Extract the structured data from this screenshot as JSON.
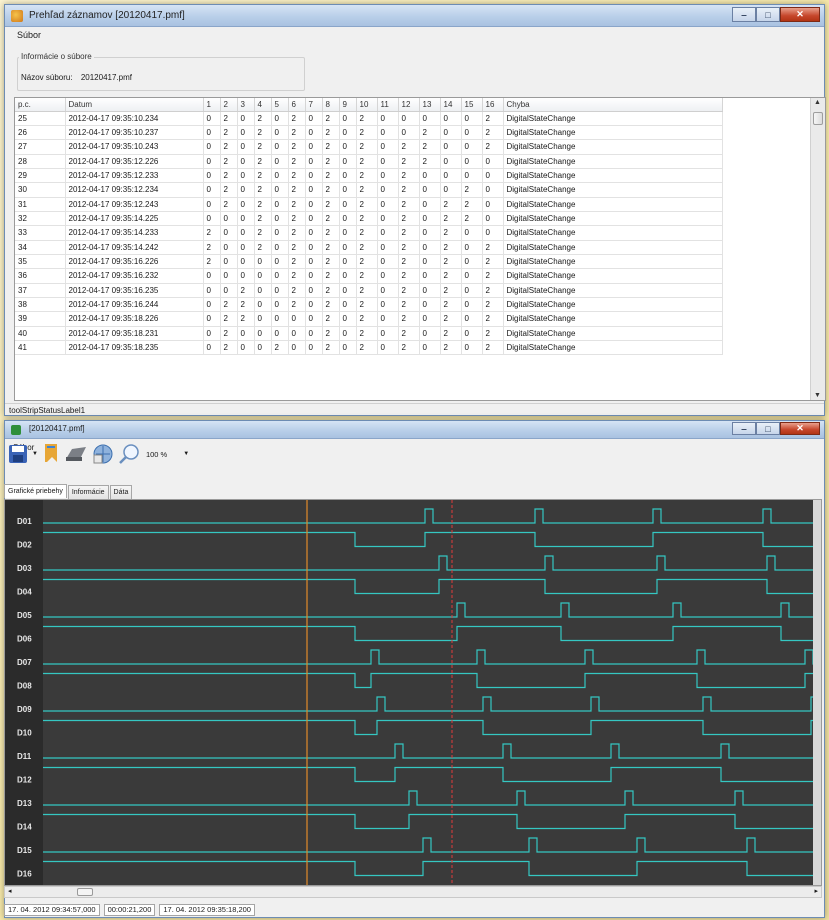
{
  "top_window": {
    "title": "Prehľad záznamov [20120417.pmf]",
    "menu": [
      "Súbor"
    ],
    "file_info": {
      "legend": "Informácie o súbore",
      "filename_label": "Názov súboru:",
      "filename_value": "20120417.pmf"
    },
    "table": {
      "columns": [
        "p.c.",
        "Datum",
        "1",
        "2",
        "3",
        "4",
        "5",
        "6",
        "7",
        "8",
        "9",
        "10",
        "11",
        "12",
        "13",
        "14",
        "15",
        "16",
        "Chyba"
      ],
      "rows": [
        [
          "25",
          "2012-04-17 09:35:10.234",
          "0",
          "2",
          "0",
          "2",
          "0",
          "2",
          "0",
          "2",
          "0",
          "2",
          "0",
          "0",
          "0",
          "0",
          "0",
          "2",
          "DigitalStateChange"
        ],
        [
          "26",
          "2012-04-17 09:35:10.237",
          "0",
          "2",
          "0",
          "2",
          "0",
          "2",
          "0",
          "2",
          "0",
          "2",
          "0",
          "0",
          "2",
          "0",
          "0",
          "2",
          "DigitalStateChange"
        ],
        [
          "27",
          "2012-04-17 09:35:10.243",
          "0",
          "2",
          "0",
          "2",
          "0",
          "2",
          "0",
          "2",
          "0",
          "2",
          "0",
          "2",
          "2",
          "0",
          "0",
          "2",
          "DigitalStateChange"
        ],
        [
          "28",
          "2012-04-17 09:35:12.226",
          "0",
          "2",
          "0",
          "2",
          "0",
          "2",
          "0",
          "2",
          "0",
          "2",
          "0",
          "2",
          "2",
          "0",
          "0",
          "0",
          "DigitalStateChange"
        ],
        [
          "29",
          "2012-04-17 09:35:12.233",
          "0",
          "2",
          "0",
          "2",
          "0",
          "2",
          "0",
          "2",
          "0",
          "2",
          "0",
          "2",
          "0",
          "0",
          "0",
          "0",
          "DigitalStateChange"
        ],
        [
          "30",
          "2012-04-17 09:35:12.234",
          "0",
          "2",
          "0",
          "2",
          "0",
          "2",
          "0",
          "2",
          "0",
          "2",
          "0",
          "2",
          "0",
          "0",
          "2",
          "0",
          "DigitalStateChange"
        ],
        [
          "31",
          "2012-04-17 09:35:12.243",
          "0",
          "2",
          "0",
          "2",
          "0",
          "2",
          "0",
          "2",
          "0",
          "2",
          "0",
          "2",
          "0",
          "2",
          "2",
          "0",
          "DigitalStateChange"
        ],
        [
          "32",
          "2012-04-17 09:35:14.225",
          "0",
          "0",
          "0",
          "2",
          "0",
          "2",
          "0",
          "2",
          "0",
          "2",
          "0",
          "2",
          "0",
          "2",
          "2",
          "0",
          "DigitalStateChange"
        ],
        [
          "33",
          "2012-04-17 09:35:14.233",
          "2",
          "0",
          "0",
          "2",
          "0",
          "2",
          "0",
          "2",
          "0",
          "2",
          "0",
          "2",
          "0",
          "2",
          "0",
          "0",
          "DigitalStateChange"
        ],
        [
          "34",
          "2012-04-17 09:35:14.242",
          "2",
          "0",
          "0",
          "2",
          "0",
          "2",
          "0",
          "2",
          "0",
          "2",
          "0",
          "2",
          "0",
          "2",
          "0",
          "2",
          "DigitalStateChange"
        ],
        [
          "35",
          "2012-04-17 09:35:16.226",
          "2",
          "0",
          "0",
          "0",
          "0",
          "2",
          "0",
          "2",
          "0",
          "2",
          "0",
          "2",
          "0",
          "2",
          "0",
          "2",
          "DigitalStateChange"
        ],
        [
          "36",
          "2012-04-17 09:35:16.232",
          "0",
          "0",
          "0",
          "0",
          "0",
          "2",
          "0",
          "2",
          "0",
          "2",
          "0",
          "2",
          "0",
          "2",
          "0",
          "2",
          "DigitalStateChange"
        ],
        [
          "37",
          "2012-04-17 09:35:16.235",
          "0",
          "0",
          "2",
          "0",
          "0",
          "2",
          "0",
          "2",
          "0",
          "2",
          "0",
          "2",
          "0",
          "2",
          "0",
          "2",
          "DigitalStateChange"
        ],
        [
          "38",
          "2012-04-17 09:35:16.244",
          "0",
          "2",
          "2",
          "0",
          "0",
          "2",
          "0",
          "2",
          "0",
          "2",
          "0",
          "2",
          "0",
          "2",
          "0",
          "2",
          "DigitalStateChange"
        ],
        [
          "39",
          "2012-04-17 09:35:18.226",
          "0",
          "2",
          "2",
          "0",
          "0",
          "0",
          "0",
          "2",
          "0",
          "2",
          "0",
          "2",
          "0",
          "2",
          "0",
          "2",
          "DigitalStateChange"
        ],
        [
          "40",
          "2012-04-17 09:35:18.231",
          "0",
          "2",
          "0",
          "0",
          "0",
          "0",
          "0",
          "2",
          "0",
          "2",
          "0",
          "2",
          "0",
          "2",
          "0",
          "2",
          "DigitalStateChange"
        ],
        [
          "41",
          "2012-04-17 09:35:18.235",
          "0",
          "2",
          "0",
          "0",
          "2",
          "0",
          "0",
          "2",
          "0",
          "2",
          "0",
          "2",
          "0",
          "2",
          "0",
          "2",
          "DigitalStateChange"
        ]
      ]
    },
    "status_label": "toolStripStatusLabel1"
  },
  "bottom_window": {
    "title": "[20120417.pmf]",
    "menu": [
      "Súbor"
    ],
    "toolbar": {
      "zoom_value": "100 %",
      "icons": [
        "save-icon",
        "dropdown-arrow-icon",
        "bookmark-icon",
        "print-icon",
        "globe-settings-icon",
        "zoom-icon"
      ]
    },
    "tabs": [
      "Grafické priebehy",
      "Informácie",
      "Dáta"
    ],
    "active_tab": 0,
    "channels": [
      "D01",
      "D02",
      "D03",
      "D04",
      "D05",
      "D06",
      "D07",
      "D08",
      "D09",
      "D10",
      "D11",
      "D12",
      "D13",
      "D14",
      "D15",
      "D16"
    ],
    "colors": {
      "plot_bg": "#3a3a3a",
      "trace": "#35c7c2",
      "cursor_orange": "#e08a2a",
      "cursor_red": "#e03a3a",
      "label_strip": "#2b2b2b"
    },
    "status": [
      "17. 04. 2012 09:34:57,000",
      "00:00:21,200",
      "17. 04. 2012 09:35:18,200"
    ]
  }
}
